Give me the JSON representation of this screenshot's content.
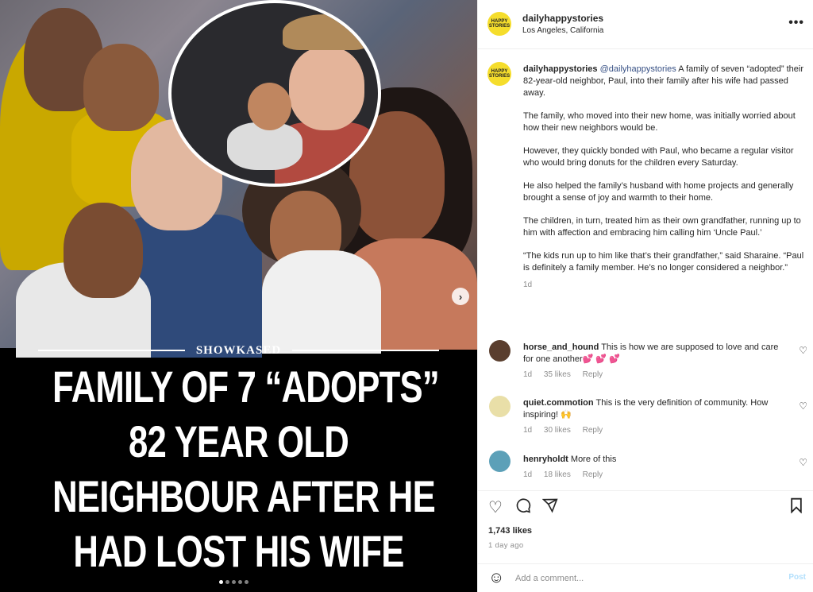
{
  "media": {
    "tag": "SHOWKASED",
    "headline": [
      "FAMILY OF 7 “ADOPTS”",
      "82 YEAR OLD",
      "NEIGHBOUR AFTER HE",
      "HAD LOST HIS WIFE"
    ],
    "slide_count": 5,
    "current_slide": 1
  },
  "post": {
    "avatar_text": "HAPPY STORIES",
    "username": "dailyhappystories",
    "location": "Los Angeles, California",
    "more_label": "•••"
  },
  "caption": {
    "username": "dailyhappystories",
    "mention": "@dailyhappystories",
    "first": "A family of seven “adopted” their 82-year-old neighbor, Paul, into their family after his wife had passed away.",
    "paragraphs": [
      "The family, who moved into their new home, was initially worried about how their new neighbors would be.",
      "However, they quickly bonded with Paul, who became a regular visitor who would bring donuts for the children every Saturday.",
      "He also helped the family’s husband with home projects and generally brought a sense of joy and warmth to their home.",
      "The children, in turn, treated him as their own grandfather, running up to him with affection and embracing him calling him ‘Uncle Paul.’",
      "“The kids run up to him like that’s their grandfather,” said Sharaine. “Paul is definitely a family member. He’s no longer considered a neighbor.”"
    ],
    "time": "1d"
  },
  "comments": [
    {
      "username": "horse_and_hound",
      "text": "This is how we are supposed to love and care for one another💕 💕 💕",
      "time": "1d",
      "likes": "35 likes",
      "reply": "Reply",
      "avatar_color": "#5a3e2e"
    },
    {
      "username": "quiet.commotion",
      "text": "This is the very definition of community. How inspiring! 🙌",
      "time": "1d",
      "likes": "30 likes",
      "reply": "Reply",
      "avatar_color": "#e9dfa8"
    },
    {
      "username": "henryholdt",
      "text": "More of this",
      "time": "1d",
      "likes": "18 likes",
      "reply": "Reply",
      "avatar_color": "#5ca0b8"
    }
  ],
  "actions": {
    "likes": "1,743 likes",
    "time": "1 day ago"
  },
  "add_comment": {
    "placeholder": "Add a comment...",
    "post_label": "Post"
  }
}
